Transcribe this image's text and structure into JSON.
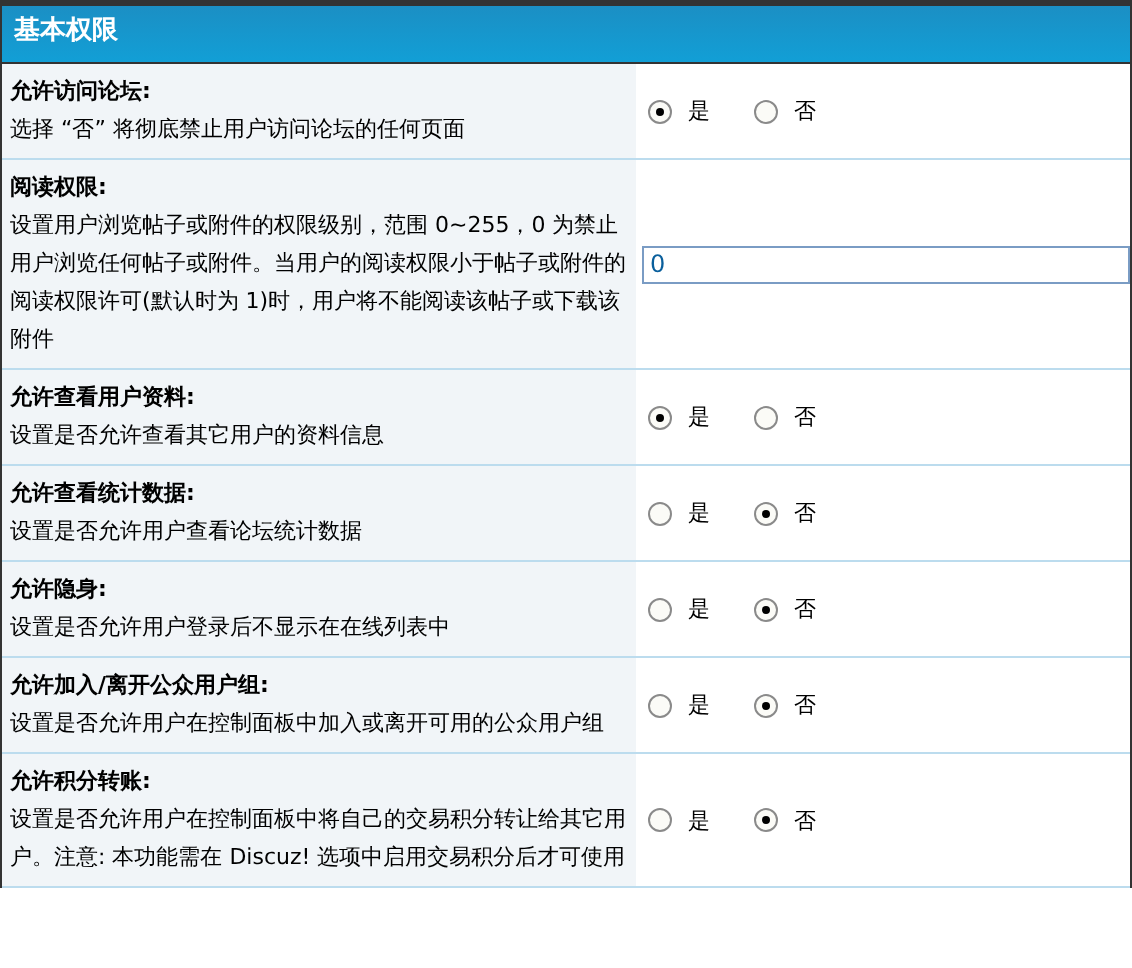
{
  "header": {
    "title": "基本权限"
  },
  "settings": [
    {
      "kind": "radio",
      "label": "允许访问论坛:",
      "description": "选择 “否” 将彻底禁止用户访问论坛的任何页面",
      "options": [
        {
          "label": "是",
          "selected": true
        },
        {
          "label": "否",
          "selected": false
        }
      ]
    },
    {
      "kind": "text",
      "label": "阅读权限:",
      "description": "设置用户浏览帖子或附件的权限级别，范围 0~255，0 为禁止用户浏览任何帖子或附件。当用户的阅读权限小于帖子或附件的阅读权限许可(默认时为 1)时，用户将不能阅读该帖子或下载该附件",
      "value": "0"
    },
    {
      "kind": "radio",
      "label": "允许查看用户资料:",
      "description": "设置是否允许查看其它用户的资料信息",
      "options": [
        {
          "label": "是",
          "selected": true
        },
        {
          "label": "否",
          "selected": false
        }
      ]
    },
    {
      "kind": "radio",
      "label": "允许查看统计数据:",
      "description": "设置是否允许用户查看论坛统计数据",
      "options": [
        {
          "label": "是",
          "selected": false
        },
        {
          "label": "否",
          "selected": true
        }
      ]
    },
    {
      "kind": "radio",
      "label": "允许隐身:",
      "description": "设置是否允许用户登录后不显示在在线列表中",
      "options": [
        {
          "label": "是",
          "selected": false
        },
        {
          "label": "否",
          "selected": true
        }
      ]
    },
    {
      "kind": "radio",
      "label": "允许加入/离开公众用户组:",
      "description": "设置是否允许用户在控制面板中加入或离开可用的公众用户组",
      "options": [
        {
          "label": "是",
          "selected": false
        },
        {
          "label": "否",
          "selected": true
        }
      ]
    },
    {
      "kind": "radio",
      "label": "允许积分转账:",
      "description": "设置是否允许用户在控制面板中将自己的交易积分转让给其它用户。注意: 本功能需在 Discuz! 选项中启用交易积分后才可使用",
      "options": [
        {
          "label": "是",
          "selected": false
        },
        {
          "label": "否",
          "selected": true
        }
      ]
    }
  ]
}
